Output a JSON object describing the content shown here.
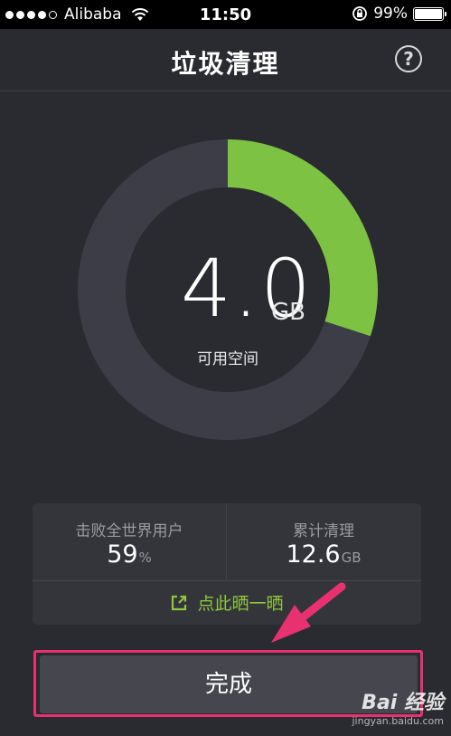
{
  "status_bar": {
    "carrier": "Alibaba",
    "time": "11:50",
    "battery": "99%",
    "battery_level": 0.99,
    "signal_bars": 4
  },
  "header": {
    "title": "垃圾清理",
    "help_label": "?"
  },
  "storage_ring": {
    "value": "4.0",
    "unit": "GB",
    "label": "可用空间",
    "available_fraction": 0.3,
    "colors": {
      "available": "#7dc242",
      "track": "#3c3d47",
      "center": "#2a2b30"
    }
  },
  "stats": {
    "defeat_label": "击败全世界用户",
    "defeat_value": "59",
    "defeat_unit": "%",
    "cleaned_label": "累计清理",
    "cleaned_value": "12.6",
    "cleaned_unit": "GB",
    "share_label": "点此晒一晒",
    "share_icon": "share-icon"
  },
  "done_button": {
    "label": "完成"
  },
  "watermark": {
    "logo": "Bai 经验",
    "url": "jingyan.baidu.com"
  },
  "annotation": {
    "arrow_color": "#e8326f"
  }
}
